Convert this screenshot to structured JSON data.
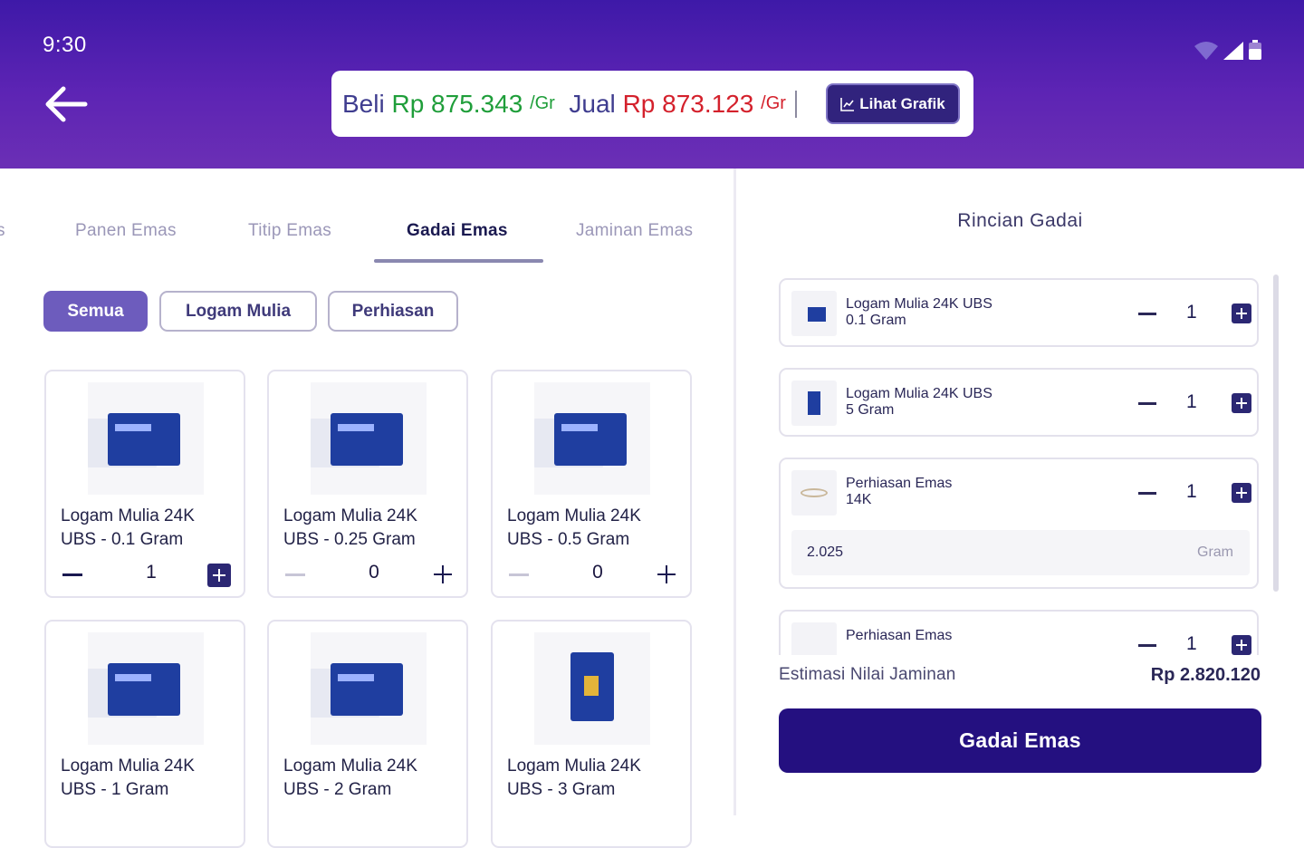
{
  "status_bar": {
    "time": "9:30"
  },
  "price": {
    "buy_label": "Beli",
    "buy_value": "Rp 875.343",
    "buy_unit": "/Gr",
    "sell_label": "Jual",
    "sell_value": "Rp 873.123",
    "sell_unit": "/Gr",
    "chart_button": "Lihat Grafik"
  },
  "tabs": [
    "s",
    "Panen Emas",
    "Titip Emas",
    "Gadai Emas",
    "Jaminan Emas"
  ],
  "active_tab": "Gadai Emas",
  "filters": [
    "Semua",
    "Logam Mulia",
    "Perhiasan"
  ],
  "products": [
    {
      "line1": "Logam Mulia 24K",
      "line2": "UBS - 0.1 Gram",
      "qty": "1"
    },
    {
      "line1": "Logam Mulia 24K",
      "line2": "UBS - 0.25 Gram",
      "qty": "0"
    },
    {
      "line1": "Logam Mulia 24K",
      "line2": "UBS - 0.5 Gram",
      "qty": "0"
    },
    {
      "line1": "Logam Mulia 24K",
      "line2": "UBS - 1 Gram",
      "qty": ""
    },
    {
      "line1": "Logam Mulia 24K",
      "line2": "UBS - 2 Gram",
      "qty": ""
    },
    {
      "line1": "Logam Mulia 24K",
      "line2": "UBS - 3 Gram",
      "qty": ""
    }
  ],
  "detail": {
    "title": "Rincian Gadai",
    "items": [
      {
        "line1": "Logam Mulia 24K UBS",
        "line2": "0.1 Gram",
        "qty": "1"
      },
      {
        "line1": "Logam Mulia 24K UBS",
        "line2": "5 Gram",
        "qty": "1"
      },
      {
        "line1": "Perhiasan Emas",
        "line2": "14K",
        "qty": "1",
        "weight": "2.025",
        "weight_unit": "Gram"
      },
      {
        "line1": "Perhiasan Emas",
        "line2": "",
        "qty": "1"
      }
    ],
    "estimate_label": "Estimasi Nilai Jaminan",
    "estimate_value": "Rp 2.820.120",
    "cta": "Gadai Emas"
  },
  "colors": {
    "header": "#4a1fae",
    "buy": "#1f9e3a",
    "sell": "#d4212c",
    "cta": "#241080"
  }
}
